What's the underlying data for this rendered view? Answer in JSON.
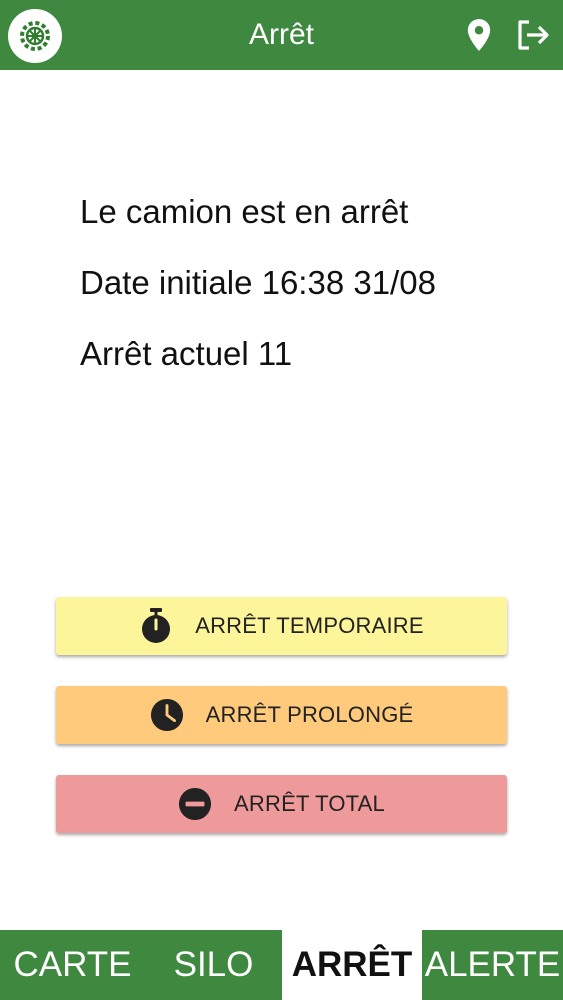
{
  "header": {
    "title": "Arrêt",
    "logo_icon": "wheel-logo-icon",
    "location_icon": "location-pin-icon",
    "logout_icon": "logout-icon",
    "color": "#3f883f"
  },
  "status": {
    "line1": "Le camion est en arrêt",
    "line2": "Date initiale 16:38 31/08",
    "line3": "Arrêt actuel 11"
  },
  "actions": [
    {
      "label": "ARRÊT TEMPORAIRE",
      "icon": "stopwatch-icon",
      "color": "#fdf59a"
    },
    {
      "label": "ARRÊT PROLONGÉ",
      "icon": "clock-icon",
      "color": "#ffca7b"
    },
    {
      "label": "ARRÊT TOTAL",
      "icon": "minus-circle-icon",
      "color": "#ef9a9a"
    }
  ],
  "bottom_nav": {
    "tabs": [
      {
        "label": "CARTE"
      },
      {
        "label": "SILO"
      },
      {
        "label": "ARRÊT"
      },
      {
        "label": "ALERTE"
      }
    ],
    "active": "ARRÊT"
  }
}
